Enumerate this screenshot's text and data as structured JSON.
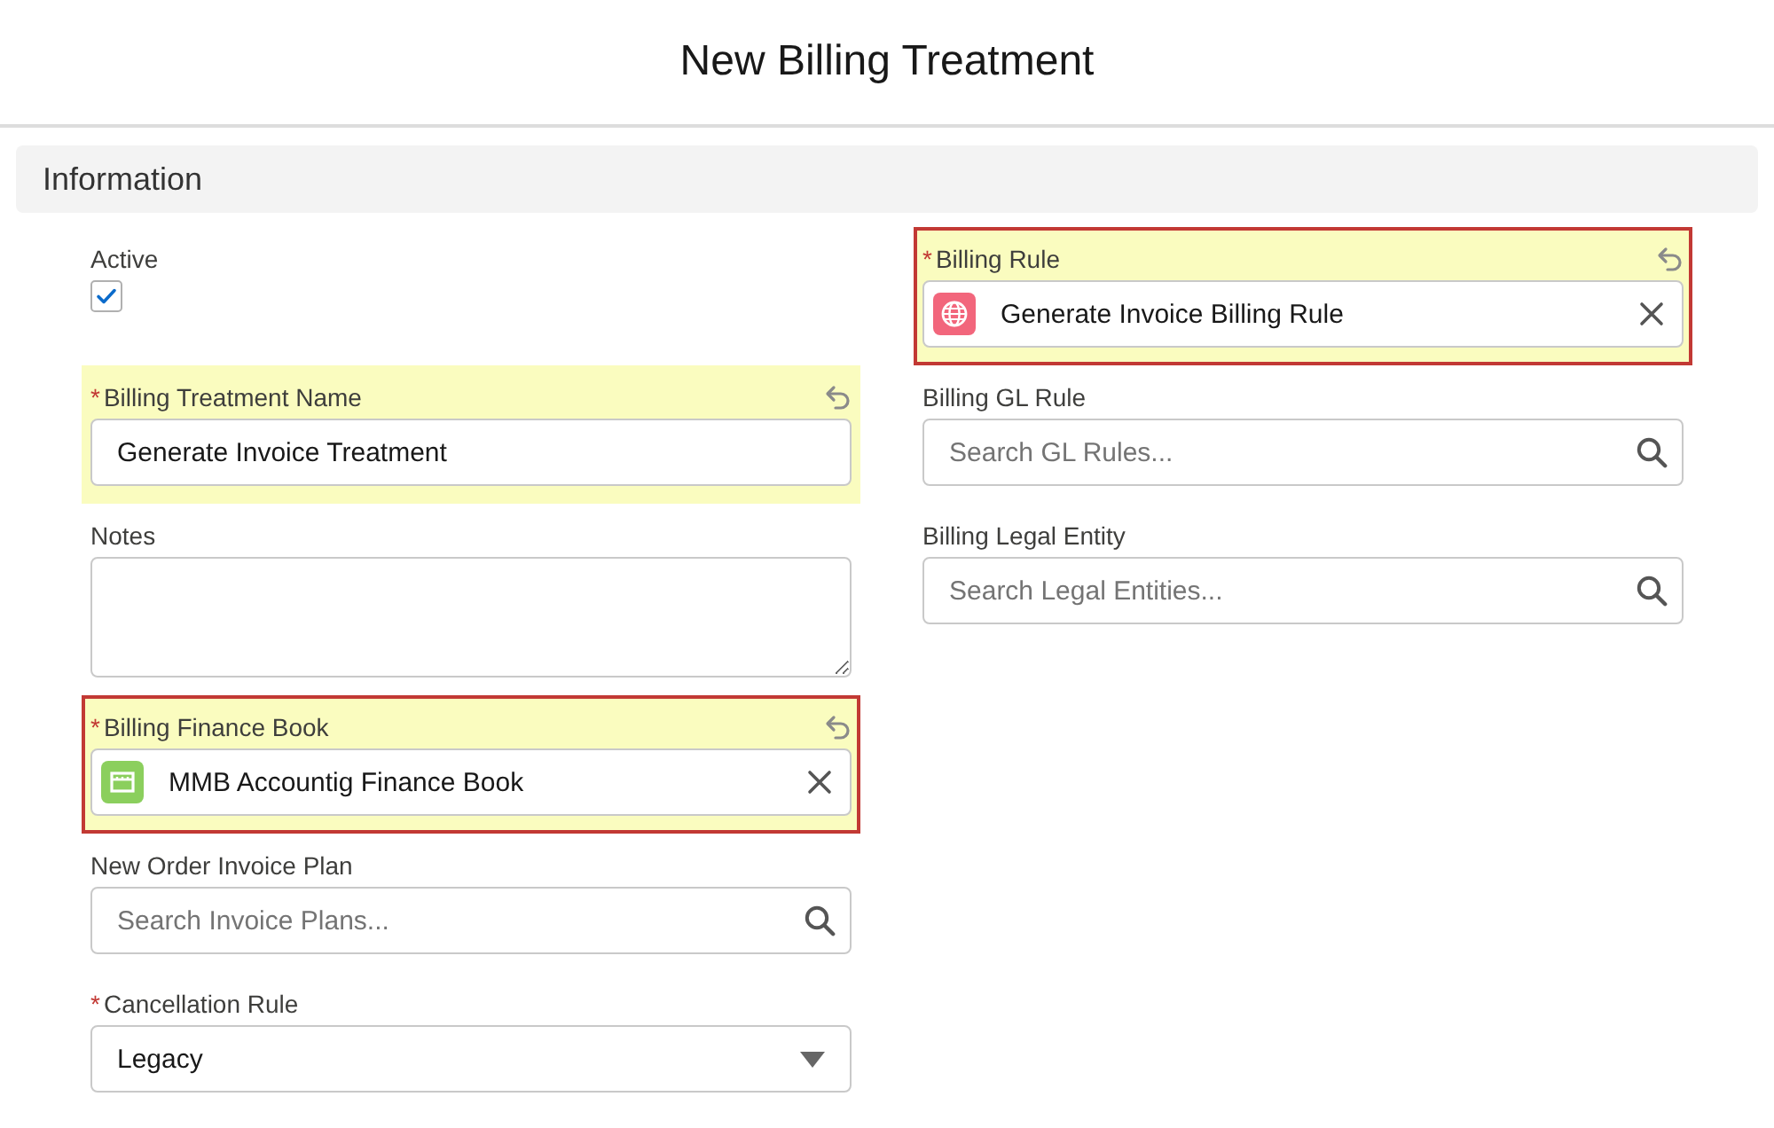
{
  "modal": {
    "title": "New Billing Treatment"
  },
  "section": {
    "title": "Information"
  },
  "columns": [
    {
      "fields": [
        {
          "kind": "checkbox",
          "label": "Active",
          "changed": false,
          "error": false,
          "checked": true
        },
        {
          "kind": "text",
          "label": "Billing Treatment Name",
          "required_mark": "*",
          "changed": true,
          "error": false,
          "value": "Generate Invoice Treatment"
        },
        {
          "kind": "textarea",
          "label": "Notes",
          "changed": false,
          "error": false
        },
        {
          "kind": "lookup",
          "label": "Billing Finance Book",
          "required_mark": "*",
          "changed": true,
          "error": true,
          "value": "MMB Accountig Finance Book"
        },
        {
          "kind": "search",
          "label": "New Order Invoice Plan",
          "changed": false,
          "error": false,
          "placeholder": "Search Invoice Plans..."
        },
        {
          "kind": "select",
          "label": "Cancellation Rule",
          "required_mark": "*",
          "changed": false,
          "error": false,
          "value": "Legacy"
        }
      ]
    },
    {
      "fields": [
        {
          "kind": "lookup",
          "label": "Billing Rule",
          "required_mark": "*",
          "changed": true,
          "error": true,
          "value": "Generate Invoice Billing Rule"
        },
        {
          "kind": "search",
          "label": "Billing GL Rule",
          "changed": false,
          "error": false,
          "placeholder": "Search GL Rules..."
        },
        {
          "kind": "search",
          "label": "Billing Legal Entity",
          "changed": false,
          "error": false,
          "placeholder": "Search Legal Entities..."
        }
      ]
    }
  ]
}
